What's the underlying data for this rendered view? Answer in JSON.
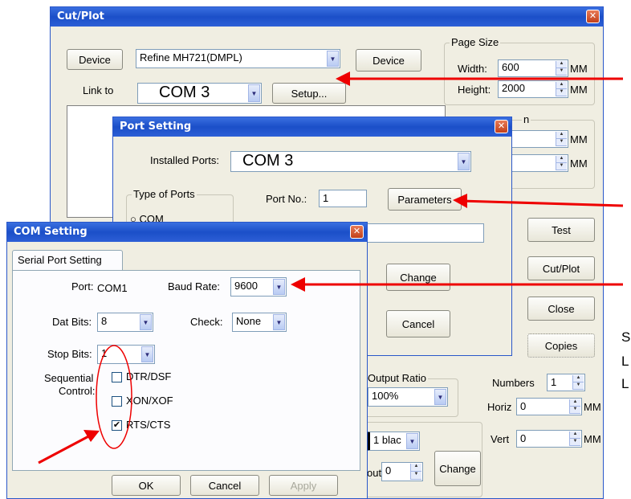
{
  "cutplot": {
    "title": "Cut/Plot",
    "close": "✕",
    "device_btn1": "Device",
    "device_value": "Refine MH721(DMPL)",
    "device_btn2": "Device",
    "link_to": "Link to",
    "link_value": "COM 3",
    "setup": "Setup...",
    "page_size": {
      "title": "Page Size",
      "width_label": "Width:",
      "width": "600",
      "height_label": "Height:",
      "height": "2000",
      "unit": "MM"
    },
    "origin": {
      "title": "n",
      "unit": "MM"
    },
    "test": "Test",
    "cutplot_btn": "Cut/Plot",
    "close_btn": "Close",
    "copies": "Copies",
    "output_ratio": {
      "title": "Output Ratio",
      "value": "100%"
    },
    "numbers_label": "Numbers",
    "numbers": "1",
    "horiz_label": "Horiz",
    "horiz": "0",
    "vert_label": "Vert",
    "vert": "0",
    "unit": "MM",
    "pen_value": "1 blac",
    "out_label": "out",
    "out_value": "0",
    "change": "Change"
  },
  "port": {
    "title": "Port Setting",
    "close": "✕",
    "installed_label": "Installed Ports:",
    "installed_value": "COM 3",
    "type_title": "Type of Ports",
    "com_label": "COM",
    "portno_label": "Port No.:",
    "portno": "1",
    "parameters": "Parameters",
    "change": "Change",
    "cancel": "Cancel"
  },
  "com": {
    "title": "COM Setting",
    "close": "✕",
    "tab": "Serial Port Setting",
    "port_label": "Port:",
    "port_value": "COM1",
    "baud_label": "Baud Rate:",
    "baud": "9600",
    "dat_label": "Dat Bits:",
    "dat": "8",
    "check_label": "Check:",
    "check": "None",
    "stop_label": "Stop Bits:",
    "stop": "1",
    "seq1": "Sequential",
    "seq2": "Control:",
    "dtr": "DTR/DSF",
    "xon": "XON/XOF",
    "rts": "RTS/CTS",
    "ok": "OK",
    "cancel": "Cancel",
    "apply": "Apply"
  },
  "side_text": [
    "S",
    "L",
    "L"
  ],
  "colors": {
    "arrow": "#ee0000",
    "title_blue": "#2355d0"
  }
}
